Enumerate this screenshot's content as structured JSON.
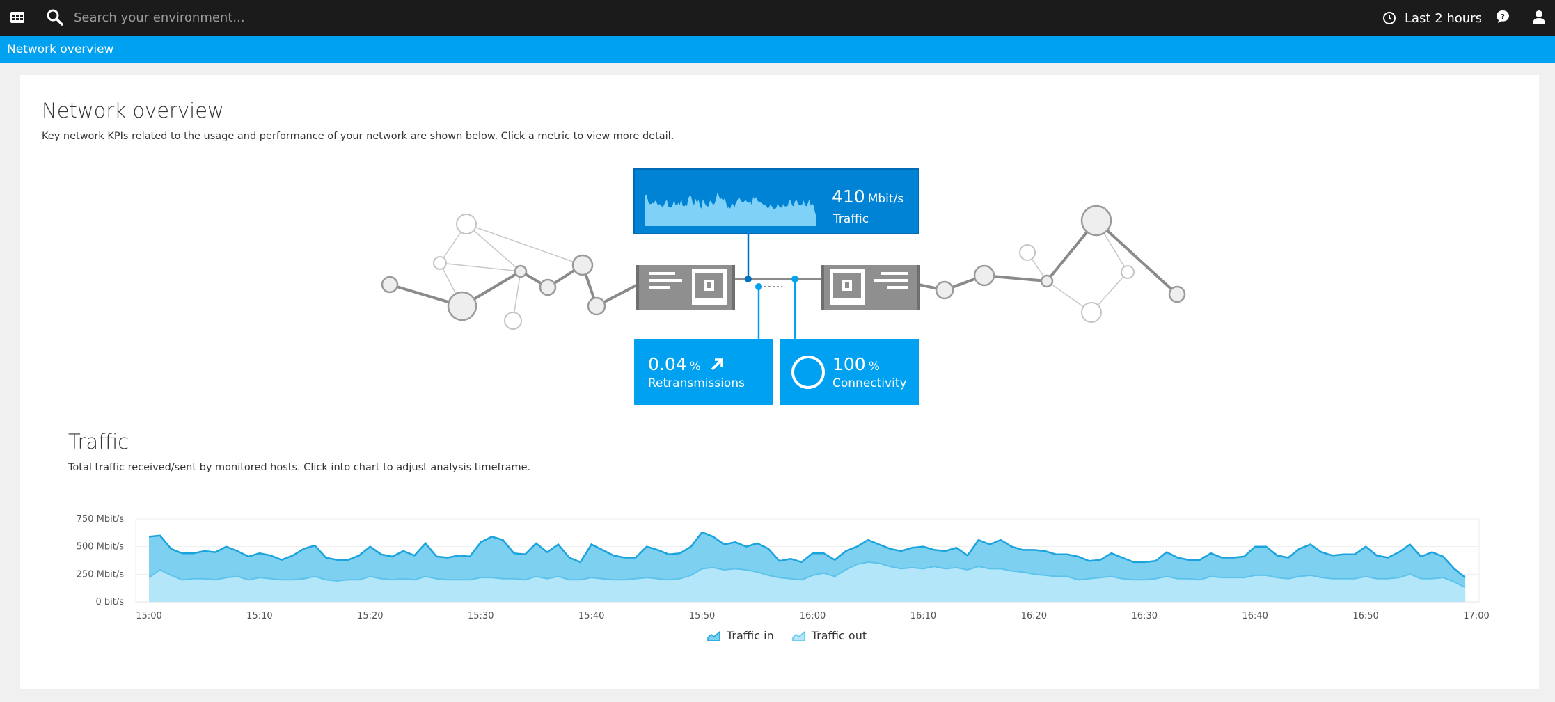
{
  "topbar": {
    "search_placeholder": "Search your environment...",
    "timeframe": "Last 2 hours"
  },
  "breadcrumb": "Network overview",
  "page": {
    "title": "Network overview",
    "description": "Key network KPIs related to the usage and performance of your network are shown below. Click a metric to view more detail."
  },
  "kpis": {
    "traffic": {
      "value": "410",
      "unit": "Mbit/s",
      "label": "Traffic"
    },
    "retransmissions": {
      "value": "0.04",
      "unit": "%",
      "label": "Retransmissions",
      "trend": "up"
    },
    "connectivity": {
      "value": "100",
      "unit": "%",
      "label": "Connectivity",
      "level": 1.0
    }
  },
  "traffic_section": {
    "title": "Traffic",
    "description": "Total traffic received/sent by monitored hosts. Click into chart to adjust analysis timeframe."
  },
  "colors": {
    "traffic_in": "#7ed0f1",
    "traffic_in_line": "#1aa3dc",
    "traffic_out": "#b3e6f8",
    "accent": "#00a1f1",
    "dark_blue": "#0083d4"
  },
  "chart_data": {
    "type": "area",
    "stacked": false,
    "y_tick_labels": [
      "750 Mbit/s",
      "500 Mbit/s",
      "250 Mbit/s",
      "0 bit/s"
    ],
    "y_ticks": [
      750,
      500,
      250,
      0
    ],
    "ylim": [
      0,
      750
    ],
    "x_tick_labels": [
      "15:00",
      "15:10",
      "15:20",
      "15:30",
      "15:40",
      "15:50",
      "16:00",
      "16:10",
      "16:20",
      "16:30",
      "16:40",
      "16:50",
      "17:00"
    ],
    "x_ticks_min": [
      0,
      10,
      20,
      30,
      40,
      50,
      60,
      70,
      80,
      90,
      100,
      110,
      120
    ],
    "xlim": [
      0,
      120
    ],
    "x_step_min": 1,
    "legend": [
      "Traffic in",
      "Traffic out"
    ],
    "series": [
      {
        "name": "Traffic in",
        "values": [
          590,
          600,
          480,
          440,
          440,
          460,
          450,
          500,
          460,
          410,
          440,
          420,
          380,
          420,
          480,
          510,
          400,
          380,
          380,
          420,
          500,
          430,
          410,
          460,
          420,
          530,
          410,
          400,
          420,
          410,
          540,
          590,
          560,
          440,
          430,
          530,
          450,
          520,
          400,
          360,
          520,
          470,
          420,
          400,
          400,
          500,
          470,
          430,
          440,
          500,
          630,
          590,
          520,
          540,
          500,
          530,
          480,
          370,
          390,
          360,
          440,
          440,
          380,
          460,
          500,
          560,
          520,
          480,
          460,
          490,
          500,
          470,
          460,
          490,
          420,
          560,
          520,
          560,
          500,
          470,
          470,
          460,
          430,
          430,
          410,
          370,
          380,
          440,
          400,
          360,
          360,
          370,
          450,
          400,
          380,
          380,
          440,
          400,
          400,
          410,
          500,
          500,
          420,
          400,
          480,
          520,
          450,
          420,
          430,
          430,
          500,
          420,
          400,
          450,
          520,
          410,
          450,
          410,
          300,
          220
        ]
      },
      {
        "name": "Traffic out",
        "values": [
          220,
          290,
          240,
          200,
          210,
          210,
          200,
          220,
          230,
          200,
          220,
          210,
          200,
          200,
          210,
          230,
          200,
          190,
          200,
          200,
          230,
          210,
          200,
          210,
          200,
          230,
          210,
          200,
          200,
          200,
          220,
          220,
          210,
          210,
          200,
          230,
          210,
          230,
          200,
          200,
          220,
          210,
          200,
          200,
          210,
          220,
          210,
          200,
          210,
          240,
          300,
          310,
          290,
          300,
          290,
          270,
          240,
          220,
          210,
          200,
          240,
          260,
          230,
          290,
          340,
          360,
          350,
          320,
          300,
          310,
          300,
          320,
          300,
          310,
          290,
          320,
          300,
          300,
          280,
          270,
          250,
          240,
          230,
          230,
          200,
          210,
          220,
          230,
          210,
          200,
          200,
          210,
          230,
          210,
          210,
          200,
          230,
          220,
          220,
          220,
          240,
          240,
          220,
          210,
          230,
          240,
          220,
          210,
          210,
          210,
          230,
          210,
          210,
          220,
          250,
          210,
          210,
          220,
          180,
          130
        ]
      }
    ]
  }
}
